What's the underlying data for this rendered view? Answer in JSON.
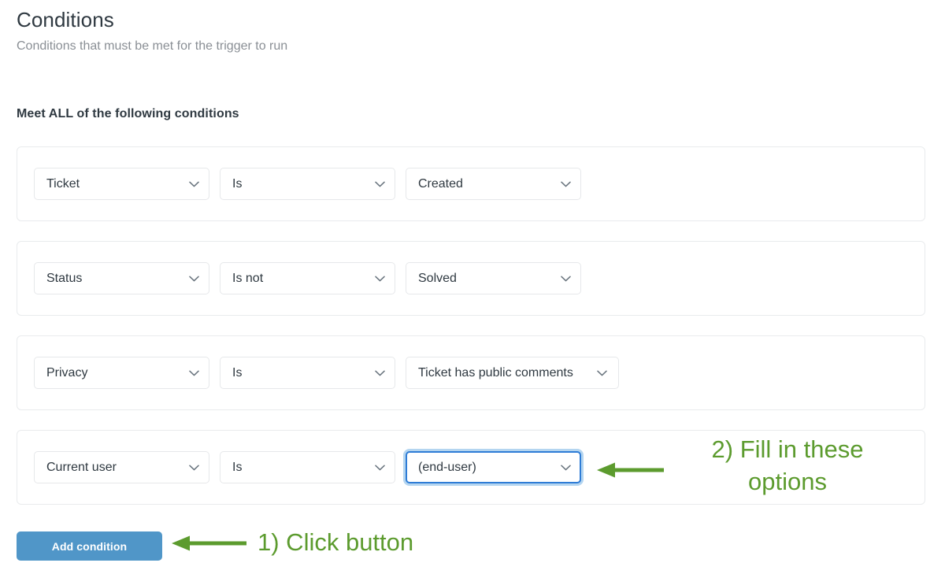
{
  "header": {
    "title": "Conditions",
    "subtitle": "Conditions that must be met for the trigger to run"
  },
  "section": {
    "label": "Meet ALL of the following conditions"
  },
  "conditions": [
    {
      "field": "Ticket",
      "operator": "Is",
      "value": "Created",
      "value_width": "fixed",
      "focused": false
    },
    {
      "field": "Status",
      "operator": "Is not",
      "value": "Solved",
      "value_width": "fixed",
      "focused": false
    },
    {
      "field": "Privacy",
      "operator": "Is",
      "value": "Ticket has public comments",
      "value_width": "auto",
      "focused": false
    },
    {
      "field": "Current user",
      "operator": "Is",
      "value": "(end-user)",
      "value_width": "fixed",
      "focused": true
    }
  ],
  "buttons": {
    "add_condition": "Add condition"
  },
  "annotations": [
    {
      "id": "step-1",
      "text": "1) Click button"
    },
    {
      "id": "step-2",
      "text": "2) Fill in these options"
    }
  ],
  "icons": {
    "chevron": "chevron-down-icon",
    "arrow": "arrow-left-icon"
  },
  "colors": {
    "accent_blue": "#5096c8",
    "focus_border": "#2e7cd6",
    "focus_glow": "#b4d5f0",
    "annotation_green": "#5c9b2e",
    "card_border": "#e9ebed",
    "text": "#2f3941",
    "muted_text": "#8a8f95"
  }
}
